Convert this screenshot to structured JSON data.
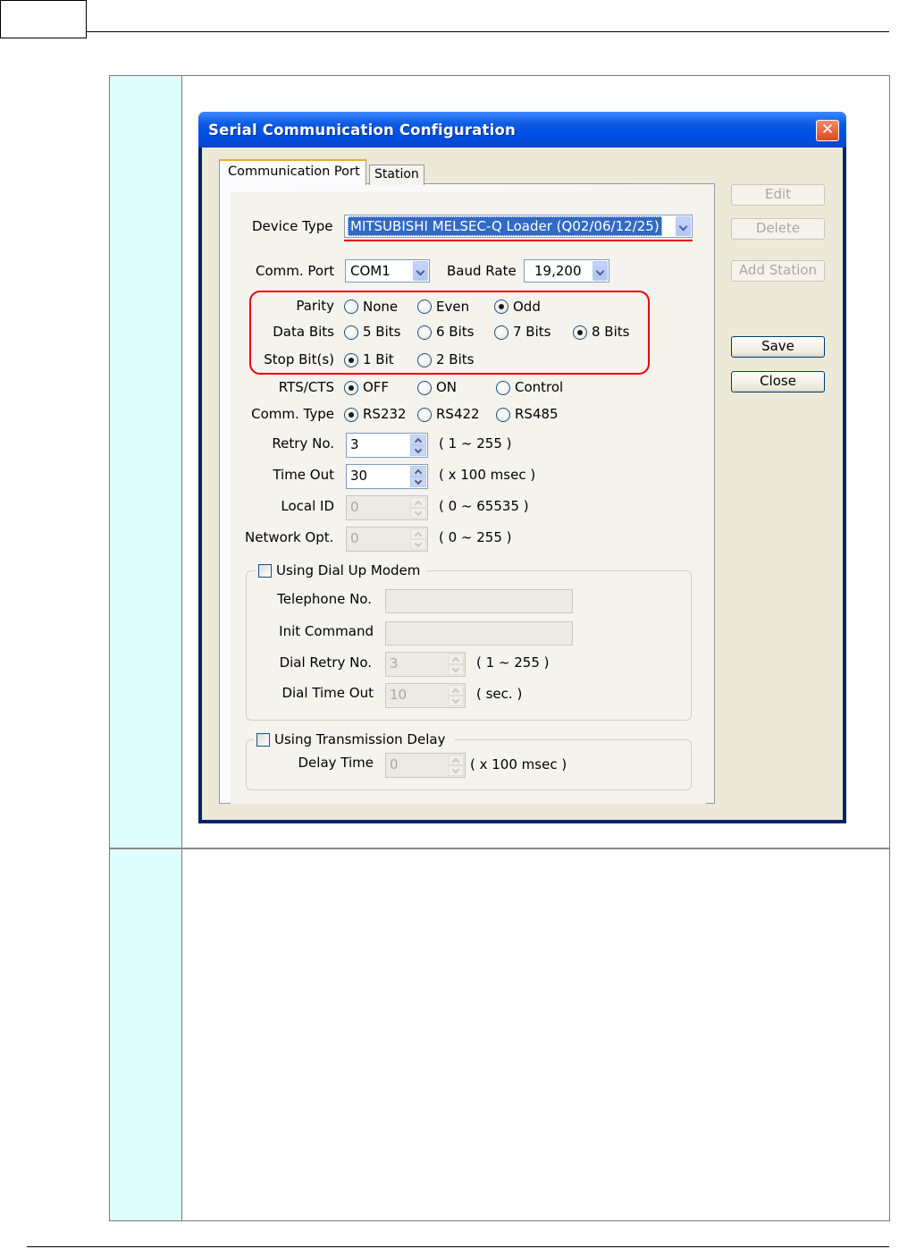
{
  "dialog": {
    "title": "Serial Communication Configuration",
    "close_glyph": "✕",
    "tabs": [
      {
        "label": "Communication Port",
        "selected": true
      },
      {
        "label": "Station",
        "selected": false
      }
    ],
    "buttons": {
      "edit": "Edit",
      "delete": "Delete",
      "add_station": "Add Station",
      "save": "Save",
      "close": "Close"
    },
    "device_type": {
      "label": "Device Type",
      "value": "MITSUBISHI MELSEC-Q Loader (Q02/06/12/25)"
    },
    "comm_port": {
      "label": "Comm. Port",
      "value": "COM1"
    },
    "baud_rate": {
      "label": "Baud Rate",
      "value": "19,200"
    },
    "parity": {
      "label": "Parity",
      "options": [
        "None",
        "Even",
        "Odd"
      ],
      "selected": "Odd"
    },
    "data_bits": {
      "label": "Data Bits",
      "options": [
        "5 Bits",
        "6 Bits",
        "7 Bits",
        "8 Bits"
      ],
      "selected": "8 Bits"
    },
    "stop_bits": {
      "label": "Stop Bit(s)",
      "options": [
        "1 Bit",
        "2 Bits"
      ],
      "selected": "1 Bit"
    },
    "rts_cts": {
      "label": "RTS/CTS",
      "options": [
        "OFF",
        "ON",
        "Control"
      ],
      "selected": "OFF"
    },
    "comm_type": {
      "label": "Comm. Type",
      "options": [
        "RS232",
        "RS422",
        "RS485"
      ],
      "selected": "RS232"
    },
    "retry_no": {
      "label": "Retry No.",
      "value": "3",
      "range": "( 1 ~ 255 )"
    },
    "time_out": {
      "label": "Time Out",
      "value": "30",
      "range": "( x 100 msec )"
    },
    "local_id": {
      "label": "Local ID",
      "value": "0",
      "range": "( 0 ~ 65535 )"
    },
    "network_opt": {
      "label": "Network Opt.",
      "value": "0",
      "range": "( 0 ~ 255 )"
    },
    "dial_up": {
      "label": "Using Dial Up Modem",
      "checked": false,
      "telephone_label": "Telephone No.",
      "init_command_label": "Init Command",
      "dial_retry": {
        "label": "Dial Retry No.",
        "value": "3",
        "range": "( 1 ~ 255 )"
      },
      "dial_timeout": {
        "label": "Dial Time Out",
        "value": "10",
        "range": "( sec. )"
      }
    },
    "transmission_delay": {
      "label": "Using Transmission Delay",
      "checked": false,
      "delay_time": {
        "label": "Delay Time",
        "value": "0",
        "range": "( x 100 msec )"
      }
    }
  }
}
